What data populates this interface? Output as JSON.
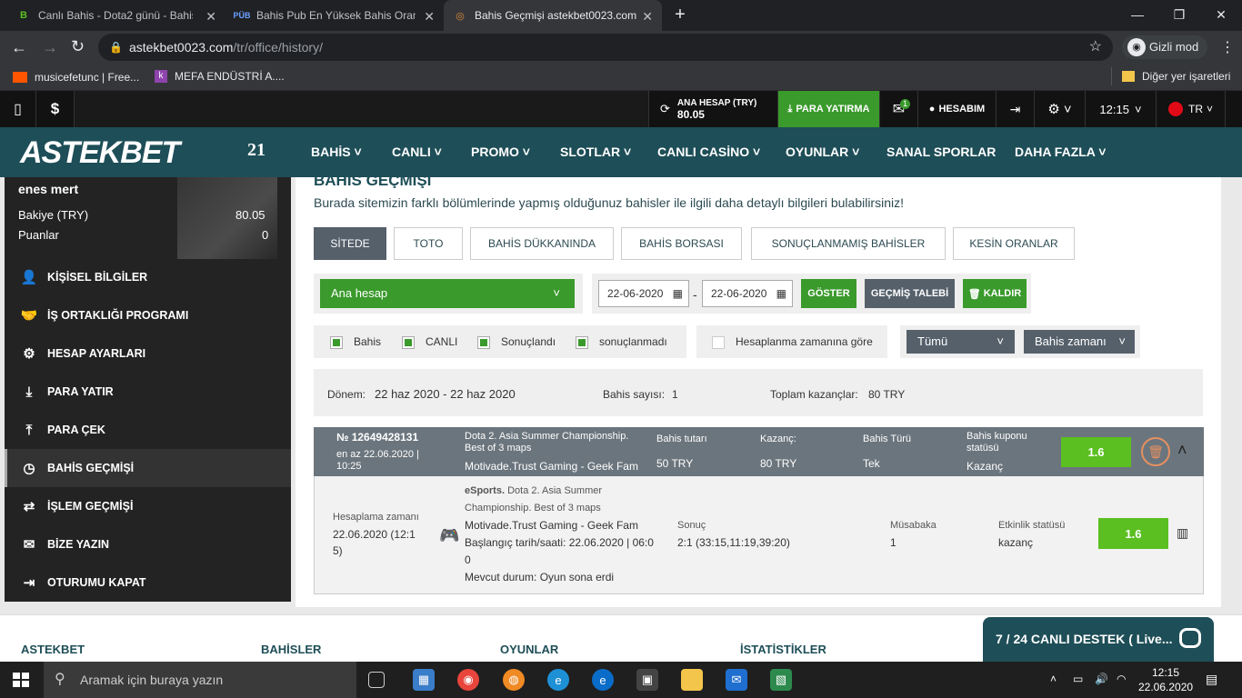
{
  "browser": {
    "tabs": [
      {
        "title": "Canlı Bahis - Dota2 günü - Bahisl"
      },
      {
        "title": "Bahis Pub En Yüksek Bahis Oranla"
      },
      {
        "title": "Bahis Geçmişi astekbet0023.com"
      }
    ],
    "url_host": "astekbet0023.com",
    "url_path": "/tr/office/history/",
    "incognito_label": "Gizli mod",
    "bookmarks": [
      {
        "label": "musicefetunc | Free..."
      },
      {
        "label": "MEFA ENDÜSTRİ A...."
      }
    ],
    "other_bookmarks": "Diğer yer işaretleri"
  },
  "site": {
    "topbar": {
      "account_label": "ANA HESAP (TRY)",
      "account_balance": "80.05",
      "deposit_label": "PARA YATIRMA",
      "mail_badge": "1",
      "my_account": "HESABIM",
      "time": "12:15",
      "lang": "TR"
    },
    "logo": "ASTEKBET",
    "logo_badge": "21",
    "nav": [
      "BAHİS",
      "CANLI",
      "PROMO",
      "SLOTLAR",
      "CANLI CASİNO",
      "OYUNLAR",
      "SANAL SPORLAR",
      "DAHA FAZLA"
    ]
  },
  "profile": {
    "name": "enes mert",
    "balance_label": "Bakiye (TRY)",
    "balance_value": "80.05",
    "points_label": "Puanlar",
    "points_value": "0"
  },
  "sidebar": {
    "items": [
      {
        "label": "KİŞİSEL BİLGİLER"
      },
      {
        "label": "İŞ ORTAKLIĞI PROGRAMI"
      },
      {
        "label": "HESAP AYARLARI"
      },
      {
        "label": "PARA YATIR"
      },
      {
        "label": "PARA ÇEK"
      },
      {
        "label": "BAHİS GEÇMİŞİ"
      },
      {
        "label": "İŞLEM GEÇMİŞİ"
      },
      {
        "label": "BİZE YAZIN"
      },
      {
        "label": "OTURUMU KAPAT"
      }
    ]
  },
  "history": {
    "title": "BAHİS GEÇMİŞİ",
    "subtitle": "Burada sitemizin farklı bölümlerinde yapmış olduğunuz bahisler ile ilgili daha detaylı bilgileri bulabilirsiniz!",
    "filters": [
      "SİTEDE",
      "TOTO",
      "BAHİS DÜKKANINDA",
      "BAHİS BORSASI",
      "SONUÇLANMAMIŞ BAHİSLER",
      "KESİN ORANLAR"
    ],
    "account_select": "Ana hesap",
    "date_from": "22-06-2020",
    "date_to": "22-06-2020",
    "show_btn": "GÖSTER",
    "history_request_btn": "GEÇMİŞ TALEBİ",
    "remove_btn": "KALDIR",
    "checkboxes": [
      {
        "label": "Bahis",
        "checked": true
      },
      {
        "label": "CANLI",
        "checked": true
      },
      {
        "label": "Sonuçlandı",
        "checked": true
      },
      {
        "label": "sonuçlanmadı",
        "checked": true
      }
    ],
    "calc_time_label": "Hesaplanma zamanına göre",
    "all_select": "Tümü",
    "bet_time_select": "Bahis zamanı",
    "summary": {
      "period_label": "Dönem:",
      "period_value": "22 haz 2020 - 22 haz 2020",
      "count_label": "Bahis sayısı:",
      "count_value": "1",
      "total_label": "Toplam kazançlar:",
      "total_value": "80 TRY"
    },
    "bet": {
      "id": "№ 12649428131",
      "date": "en az 22.06.2020 |",
      "time": "10:25",
      "event_line1": "Dota 2. Asia Summer Championship.",
      "event_line2": "Best of 3 maps",
      "match": "Motivade.Trust Gaming - Geek Fam",
      "stake_label": "Bahis tutarı",
      "stake_value": "50 TRY",
      "win_label": "Kazanç:",
      "win_value": "80 TRY",
      "type_label": "Bahis Türü",
      "type_value": "Tek",
      "status_label_1": "Bahis kuponu",
      "status_label_2": "statüsü",
      "status_value": "Kazanç",
      "odds": "1.6"
    },
    "detail": {
      "calc_label": "Hesaplama zamanı",
      "calc_line1": "22.06.2020 (12:1",
      "calc_line2": "5)",
      "sport": "eSports.",
      "league_1": "Dota 2. Asia Summer",
      "league_2": "Championship. Best of 3 maps",
      "match": "Motivade.Trust Gaming - Geek Fam",
      "start_1": "Başlangıç tarih/saati: 22.06.2020 | 06:0",
      "start_2": "0",
      "state": "Mevcut durum: Oyun sona erdi",
      "result_label": "Sonuç",
      "result_value": "2:1 (33:15,11:19,39:20)",
      "match_label": "Müsabaka",
      "match_value": "1",
      "event_status_label": "Etkinlik statüsü",
      "event_status_value": "kazanç",
      "odds": "1.6"
    }
  },
  "footer": {
    "cols": [
      "ASTEKBET",
      "BAHİSLER",
      "OYUNLAR",
      "İSTATİSTİKLER"
    ],
    "chat": "7 / 24 CANLI DESTEK ( Live..."
  },
  "taskbar": {
    "search_placeholder": "Aramak için buraya yazın",
    "time": "12:15",
    "date": "22.06.2020"
  },
  "colors": {
    "nav_bg": "#1e4e57",
    "green": "#3a9a2c",
    "odds_green": "#5bbf21"
  }
}
